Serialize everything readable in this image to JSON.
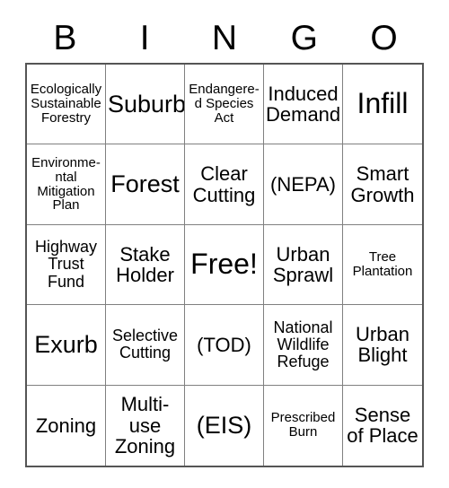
{
  "card": {
    "header": [
      "B",
      "I",
      "N",
      "G",
      "O"
    ],
    "rows": [
      [
        {
          "text": "Ecologically Sustainable Forestry",
          "size": "fs-xs",
          "free": false
        },
        {
          "text": "Suburb",
          "size": "fs-lg",
          "free": false
        },
        {
          "text": "Endangere-d Species Act",
          "size": "fs-xs",
          "free": false
        },
        {
          "text": "Induced Demand",
          "size": "fs-md",
          "free": false
        },
        {
          "text": "Infill",
          "size": "fs-xl",
          "free": false
        }
      ],
      [
        {
          "text": "Environme-ntal Mitigation Plan",
          "size": "fs-xs",
          "free": false
        },
        {
          "text": "Forest",
          "size": "fs-lg",
          "free": false
        },
        {
          "text": "Clear Cutting",
          "size": "fs-md",
          "free": false
        },
        {
          "text": "(NEPA)",
          "size": "fs-md",
          "free": false
        },
        {
          "text": "Smart Growth",
          "size": "fs-md",
          "free": false
        }
      ],
      [
        {
          "text": "Highway Trust Fund",
          "size": "fs-sm",
          "free": false
        },
        {
          "text": "Stake Holder",
          "size": "fs-md",
          "free": false
        },
        {
          "text": "Free!",
          "size": "fs-xl",
          "free": true
        },
        {
          "text": "Urban Sprawl",
          "size": "fs-md",
          "free": false
        },
        {
          "text": "Tree Plantation",
          "size": "fs-xs",
          "free": false
        }
      ],
      [
        {
          "text": "Exurb",
          "size": "fs-lg",
          "free": false
        },
        {
          "text": "Selective Cutting",
          "size": "fs-sm",
          "free": false
        },
        {
          "text": "(TOD)",
          "size": "fs-md",
          "free": false
        },
        {
          "text": "National Wildlife Refuge",
          "size": "fs-sm",
          "free": false
        },
        {
          "text": "Urban Blight",
          "size": "fs-md",
          "free": false
        }
      ],
      [
        {
          "text": "Zoning",
          "size": "fs-md",
          "free": false
        },
        {
          "text": "Multi-use Zoning",
          "size": "fs-md",
          "free": false
        },
        {
          "text": "(EIS)",
          "size": "fs-lg",
          "free": false
        },
        {
          "text": "Prescribed Burn",
          "size": "fs-xs",
          "free": false
        },
        {
          "text": "Sense of Place",
          "size": "fs-md",
          "free": false
        }
      ]
    ]
  }
}
